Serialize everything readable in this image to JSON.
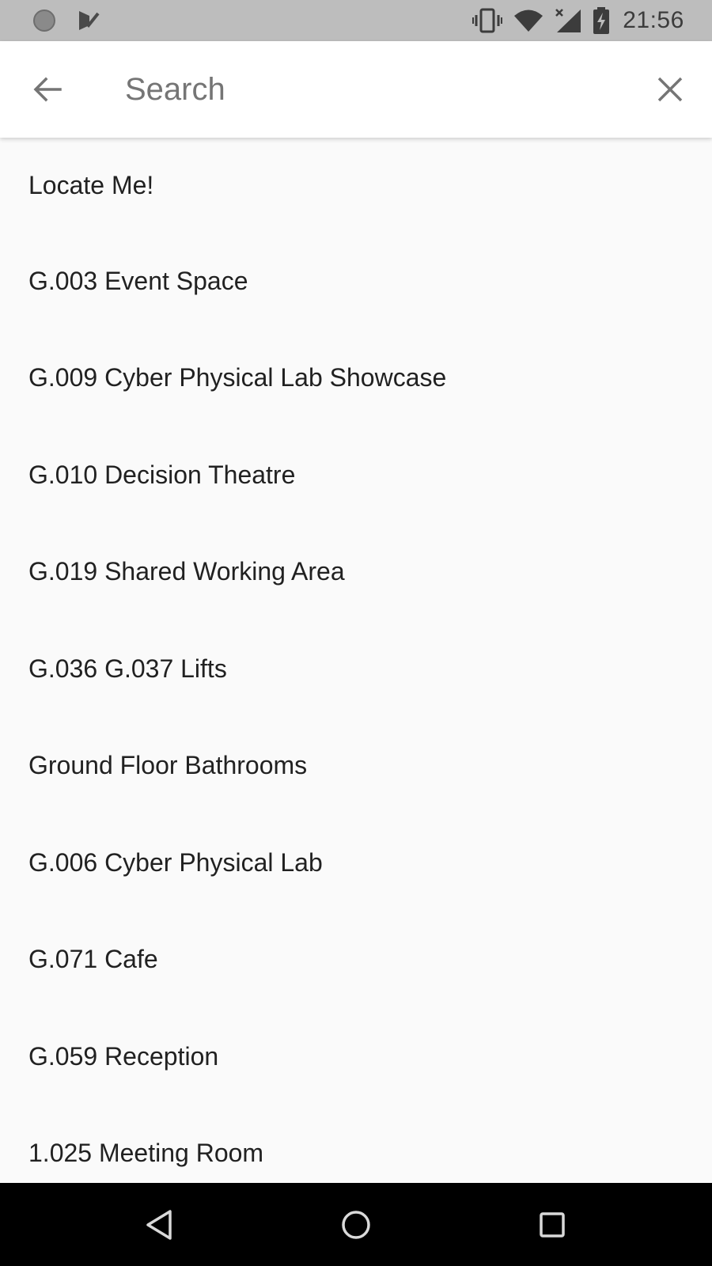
{
  "status_bar": {
    "time": "21:56",
    "left_icons": [
      "circle-notification-icon",
      "checkmark-notification-icon"
    ],
    "right_icons": [
      "vibrate-icon",
      "wifi-icon",
      "signal-no-data-icon",
      "battery-charging-icon"
    ]
  },
  "search": {
    "placeholder": "Search",
    "value": "",
    "back_icon": "arrow-back-icon",
    "clear_icon": "close-icon"
  },
  "results": [
    "Locate Me!",
    "G.003 Event Space",
    "G.009 Cyber Physical Lab Showcase",
    "G.010 Decision Theatre",
    "G.019 Shared Working Area",
    "G.036 G.037 Lifts",
    "Ground Floor Bathrooms",
    "G.006 Cyber Physical Lab",
    "G.071 Cafe",
    "G.059 Reception",
    "1.025 Meeting Room"
  ],
  "nav_bar": {
    "buttons": [
      "back-triangle-icon",
      "home-circle-icon",
      "recents-square-icon"
    ]
  },
  "colors": {
    "status_bar_bg": "#bdbdbd",
    "app_bar_bg": "#ffffff",
    "list_bg": "#fafafa",
    "nav_bar_bg": "#000000",
    "text_primary": "#212121",
    "placeholder": "#757575",
    "icon_grey": "#757575"
  }
}
